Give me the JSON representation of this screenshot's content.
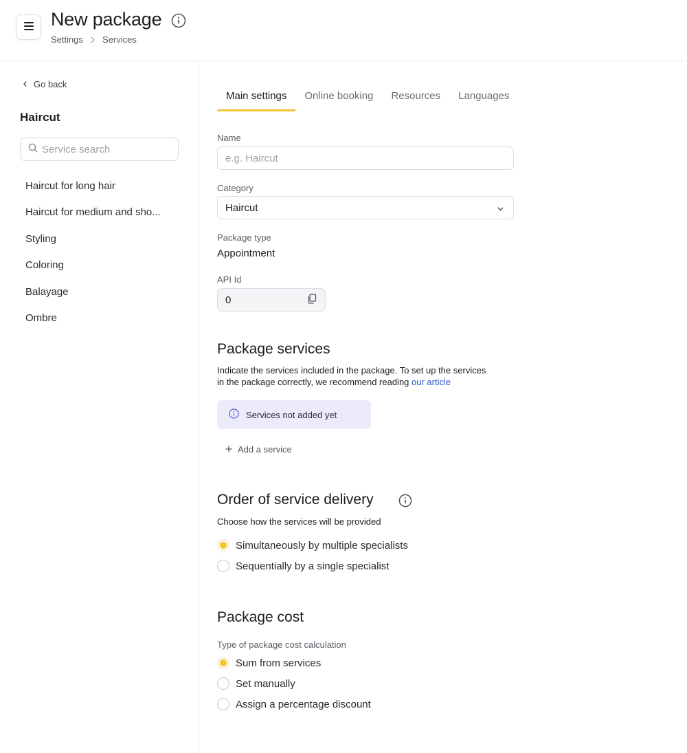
{
  "header": {
    "title": "New package",
    "breadcrumb": [
      "Settings",
      "Services"
    ]
  },
  "sidebar": {
    "back_label": "Go back",
    "title": "Haircut",
    "search_placeholder": "Service search",
    "items": [
      "Haircut for long hair",
      "Haircut for medium and sho...",
      "Styling",
      "Coloring",
      "Balayage",
      "Ombre"
    ]
  },
  "tabs": [
    "Main settings",
    "Online booking",
    "Resources",
    "Languages"
  ],
  "form": {
    "name_label": "Name",
    "name_placeholder": "e.g. Haircut",
    "name_value": "",
    "category_label": "Category",
    "category_value": "Haircut",
    "package_type_label": "Package type",
    "package_type_value": "Appointment",
    "api_id_label": "API Id",
    "api_id_value": "0"
  },
  "package_services": {
    "title": "Package services",
    "desc_line1": "Indicate the services included in the package. To set up the services",
    "desc_line2": "in the package correctly, we recommend reading ",
    "link_text": "our article",
    "notice": "Services not added yet",
    "add_label": "Add a service"
  },
  "delivery": {
    "title": "Order of service delivery",
    "desc": "Choose how the services will be provided",
    "options": [
      {
        "label": "Simultaneously by multiple specialists",
        "checked": true
      },
      {
        "label": "Sequentially by a single specialist",
        "checked": false
      }
    ]
  },
  "cost": {
    "title": "Package cost",
    "subtitle": "Type of package cost calculation",
    "options": [
      {
        "label": "Sum from services",
        "checked": true
      },
      {
        "label": "Set manually",
        "checked": false
      },
      {
        "label": "Assign a percentage discount",
        "checked": false
      }
    ]
  },
  "colors": {
    "accent": "#f5c531",
    "link": "#2f56c9",
    "notice_bg": "#ebebfa"
  }
}
